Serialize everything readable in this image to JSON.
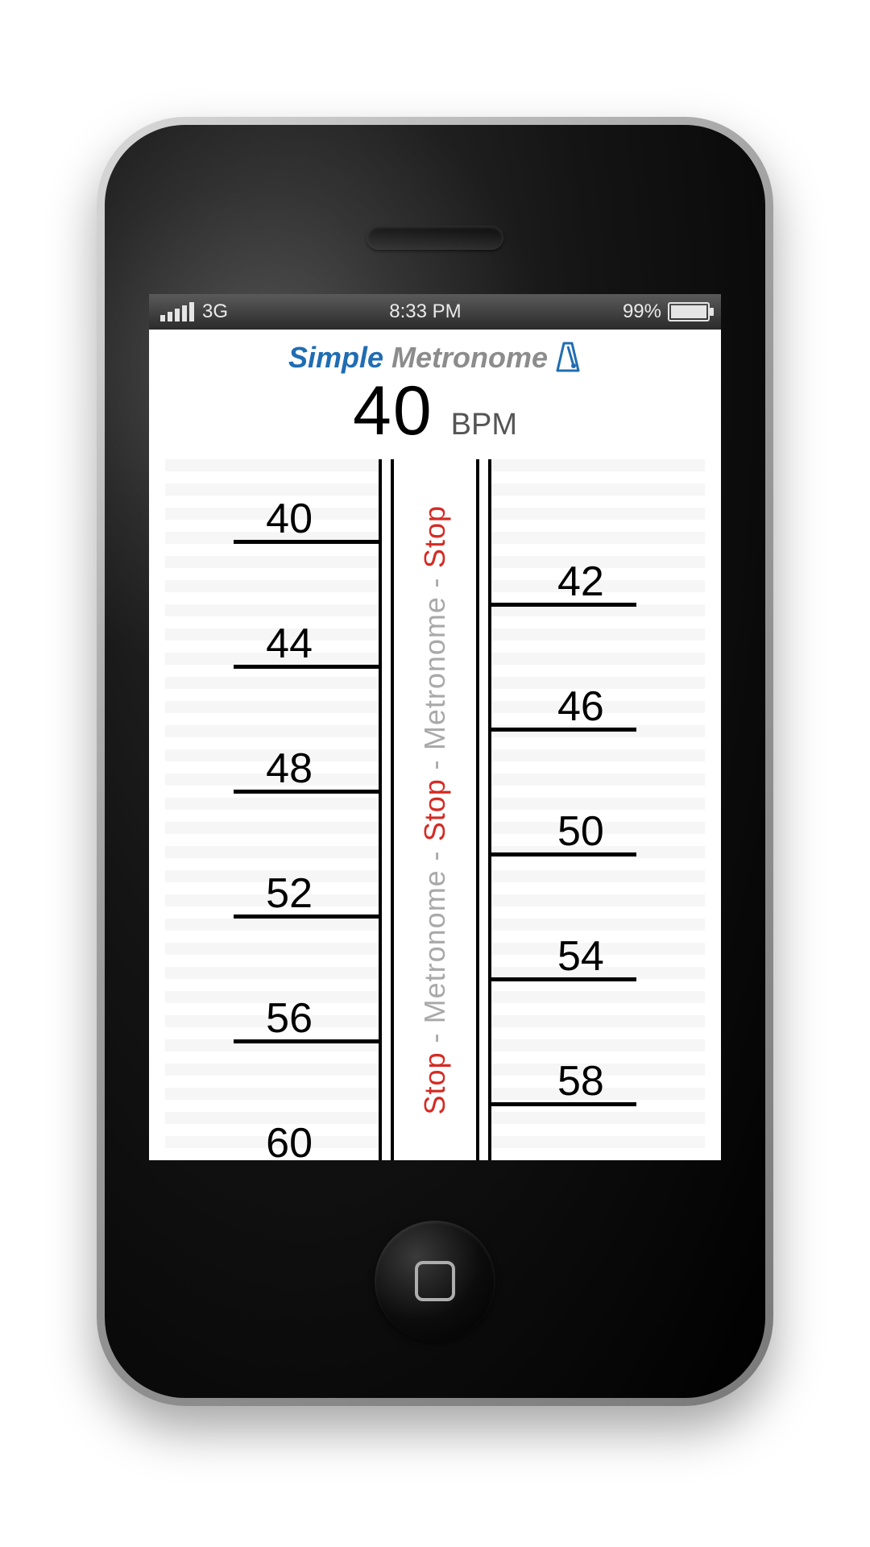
{
  "statusbar": {
    "network": "3G",
    "time": "8:33 PM",
    "battery_pct": "99%"
  },
  "app": {
    "title_simple": "Simple",
    "title_metronome": " Metronome"
  },
  "bpm": {
    "value": "40",
    "unit": "BPM"
  },
  "scale": {
    "left": [
      "40",
      "44",
      "48",
      "52",
      "56",
      "60"
    ],
    "right": [
      "42",
      "46",
      "50",
      "54",
      "58"
    ]
  },
  "center_strip": {
    "stop": "Stop",
    "metronome": "Metronome"
  }
}
